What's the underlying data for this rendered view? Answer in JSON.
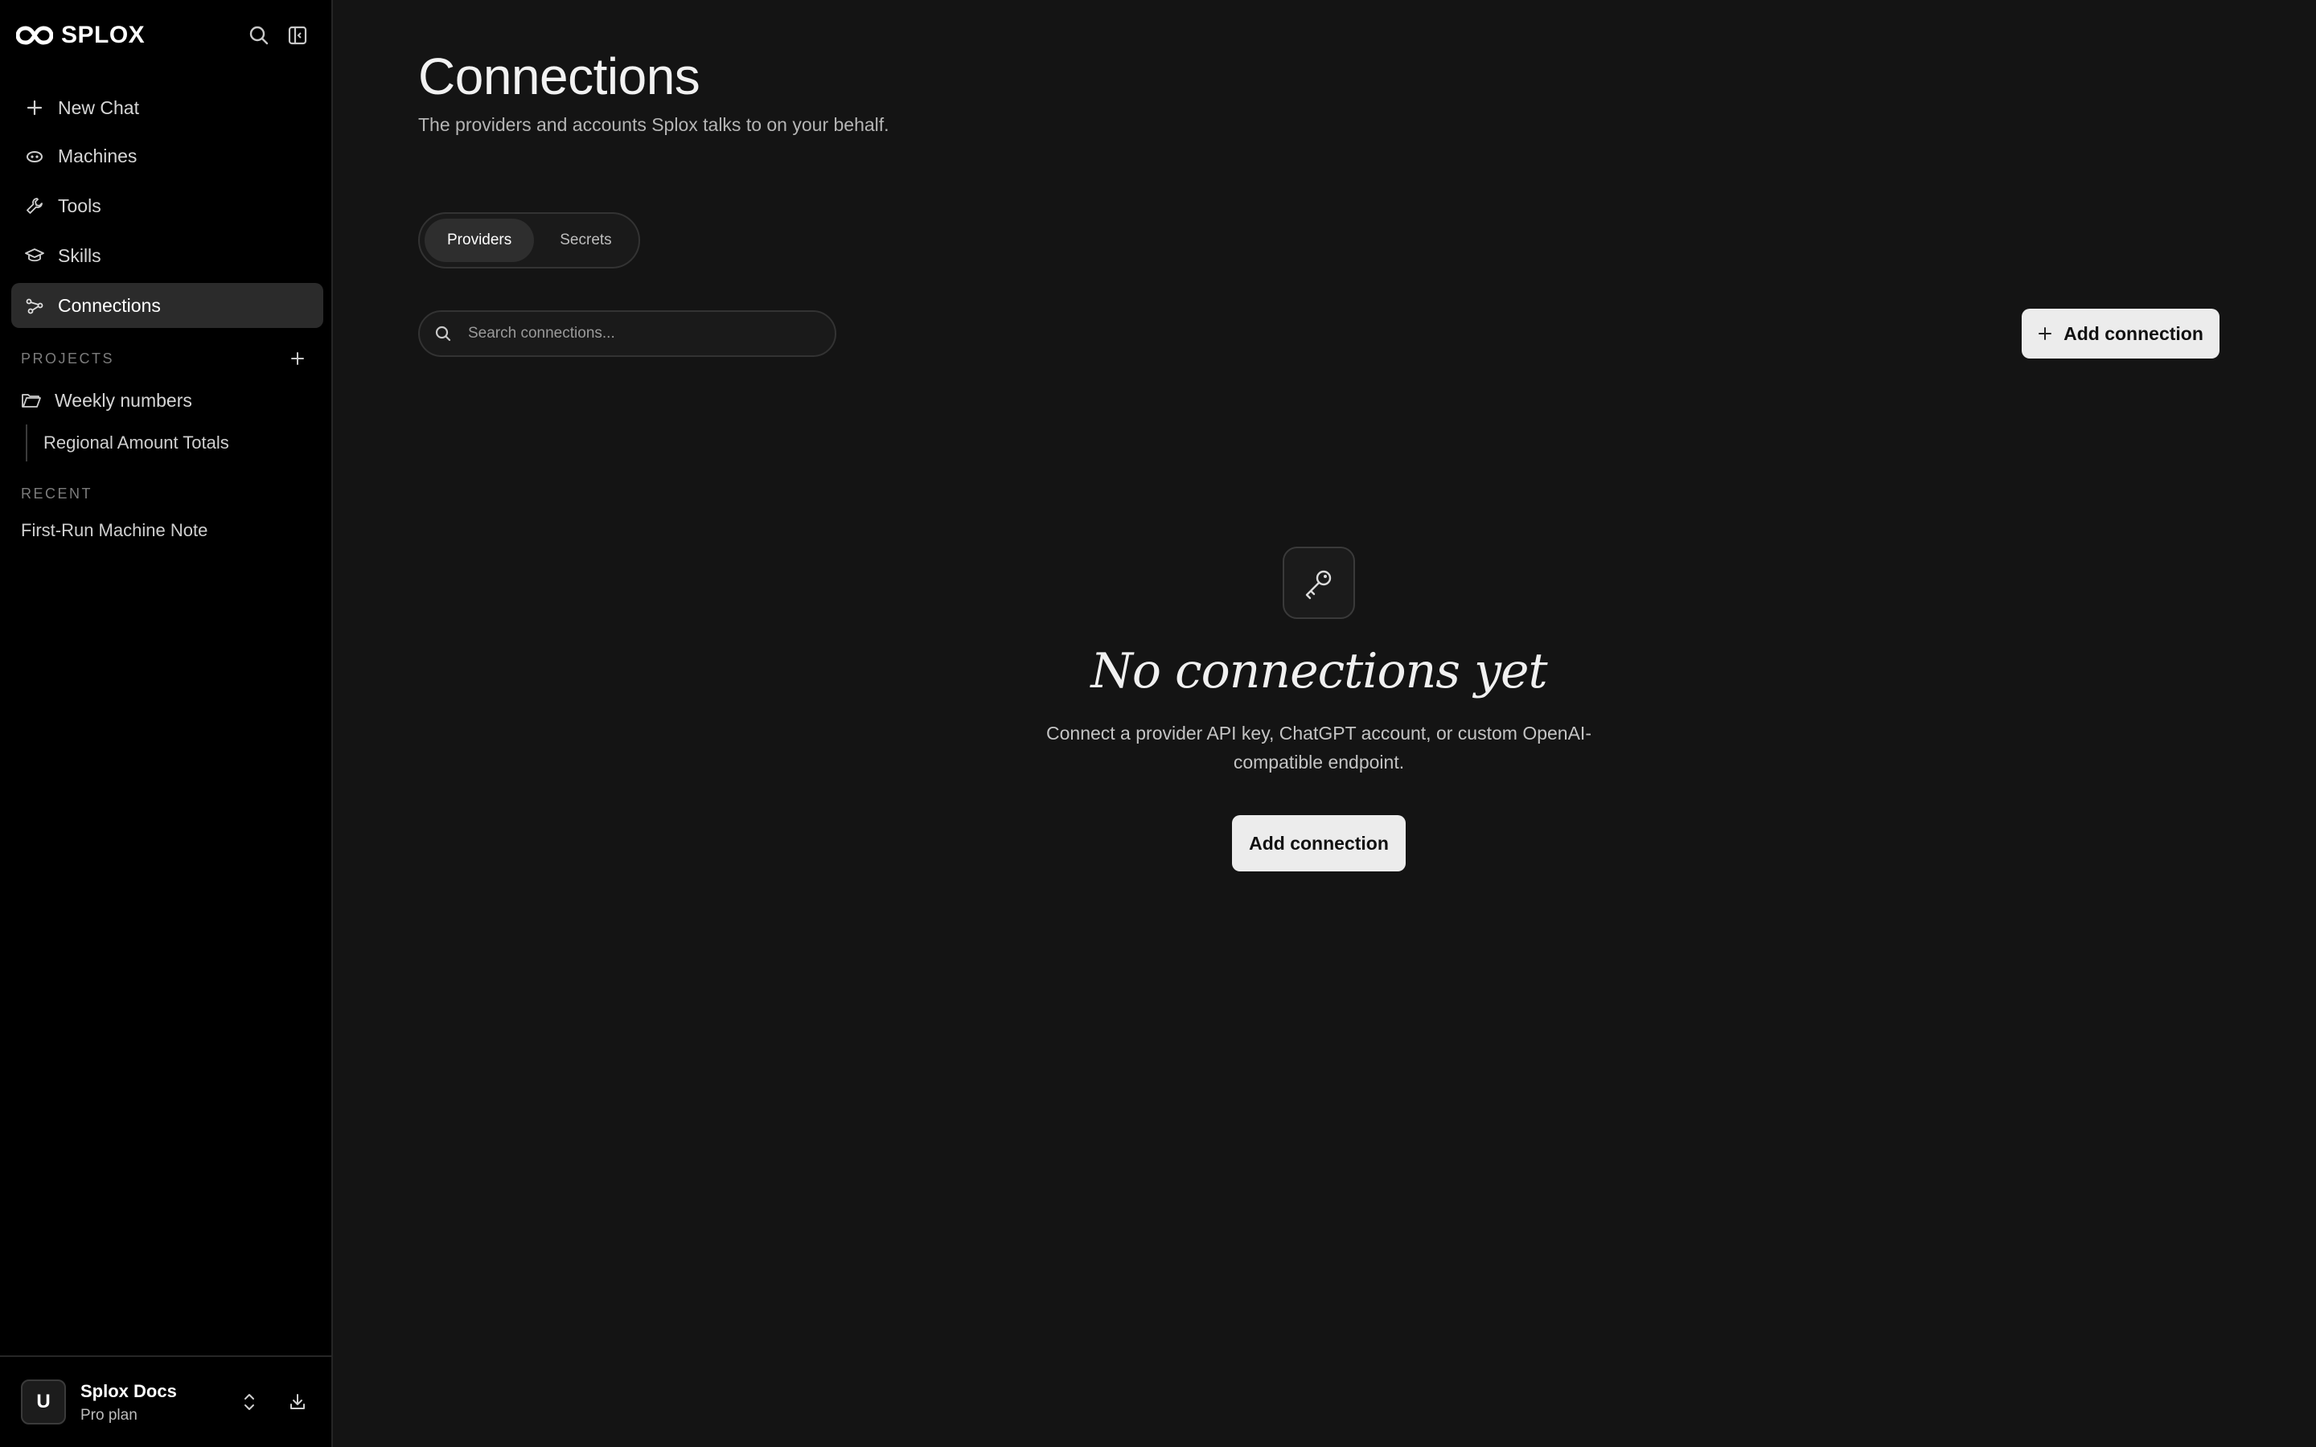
{
  "app": {
    "brand": "SPLOX"
  },
  "sidebar": {
    "nav": [
      {
        "label": "New Chat",
        "icon": "plus-icon"
      },
      {
        "label": "Machines",
        "icon": "robot-icon"
      },
      {
        "label": "Tools",
        "icon": "wrench-icon"
      },
      {
        "label": "Skills",
        "icon": "graduation-cap-icon"
      },
      {
        "label": "Connections",
        "icon": "connections-icon",
        "active": true
      }
    ],
    "projects_label": "PROJECTS",
    "project": {
      "name": "Weekly numbers",
      "children": [
        "Regional Amount Totals"
      ]
    },
    "recent_label": "RECENT",
    "recent": [
      "First-Run Machine Note"
    ],
    "account": {
      "initial": "U",
      "name": "Splox Docs",
      "plan": "Pro plan"
    }
  },
  "main": {
    "title": "Connections",
    "subtitle": "The providers and accounts Splox talks to on your behalf.",
    "tabs": [
      {
        "label": "Providers",
        "active": true
      },
      {
        "label": "Secrets",
        "active": false
      }
    ],
    "search": {
      "placeholder": "Search connections...",
      "value": ""
    },
    "add_button": "Add connection",
    "empty": {
      "icon": "key-icon",
      "title": "No connections yet",
      "description": "Connect a provider API key, ChatGPT account, or custom OpenAI-compatible endpoint.",
      "button": "Add connection"
    }
  },
  "colors": {
    "sidebar_bg": "#000000",
    "main_bg": "#141414",
    "active_item_bg": "#2b2b2b",
    "button_bg": "#ececec"
  }
}
